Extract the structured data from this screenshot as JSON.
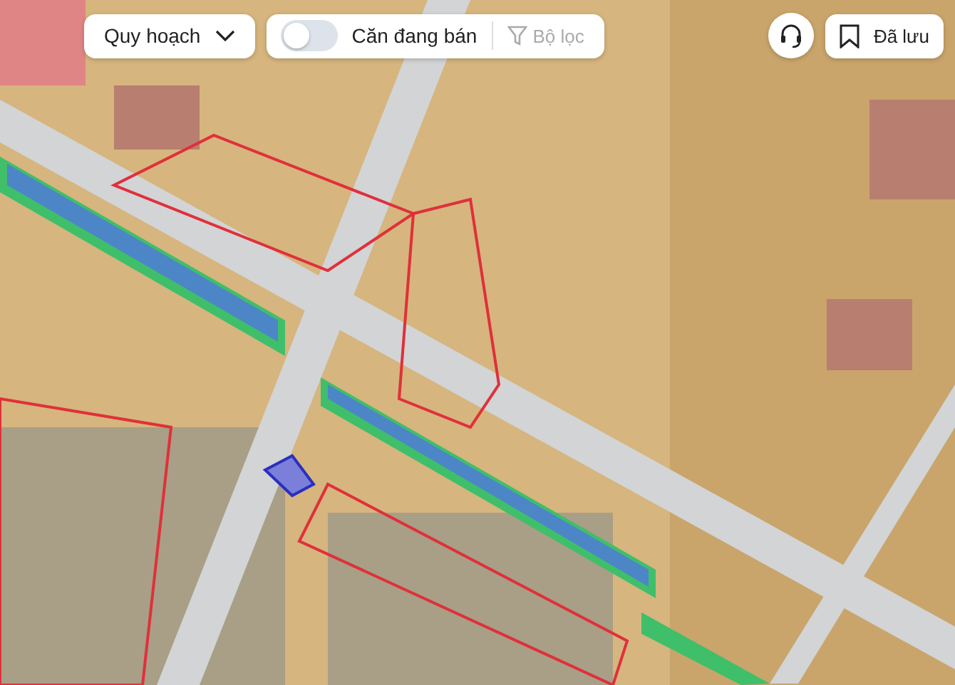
{
  "map": {
    "kind": "planning"
  },
  "toolbar": {
    "layer_dropdown": {
      "label": "Quy hoạch"
    },
    "listing_toggle": {
      "label": "Căn đang bán",
      "on": false
    },
    "filter": {
      "label": "Bộ lọc",
      "disabled": true
    },
    "saved": {
      "label": "Đã lưu"
    }
  }
}
